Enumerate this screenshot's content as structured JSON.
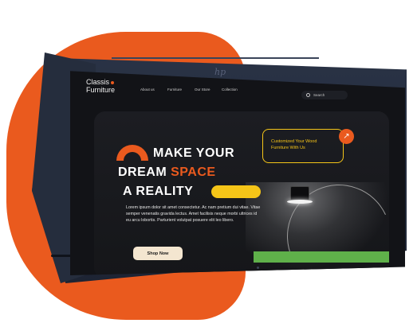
{
  "brand": {
    "line1": "Classis",
    "line2": "Furniture"
  },
  "nav": {
    "links": [
      "About us",
      "Furniture",
      "Our Store",
      "Collection"
    ]
  },
  "search": {
    "label": "Search"
  },
  "hero": {
    "line1": "MAKE YOUR",
    "line2_prefix": "DREAM",
    "line2_accent": "SPACE",
    "line3": "A REALITY",
    "body": "Lorem ipsum dolor sit amet consectetur. Ac nam pretium dui vitae. Vitae semper venenatis gravida lectus. Amet facilisis neque morbi ultrices id eu arcu lobortis. Parturient volutpat posuere elit leo libero.",
    "cta": "Shop Now"
  },
  "promo_card": {
    "line1": "Customized Your Wood",
    "line2": "Furniture With Us",
    "arrow": "↗"
  },
  "device": {
    "logo": "hp"
  },
  "colors": {
    "accent": "#ea5a1e",
    "highlight": "#f5c518",
    "screen_bg": "#121317"
  }
}
